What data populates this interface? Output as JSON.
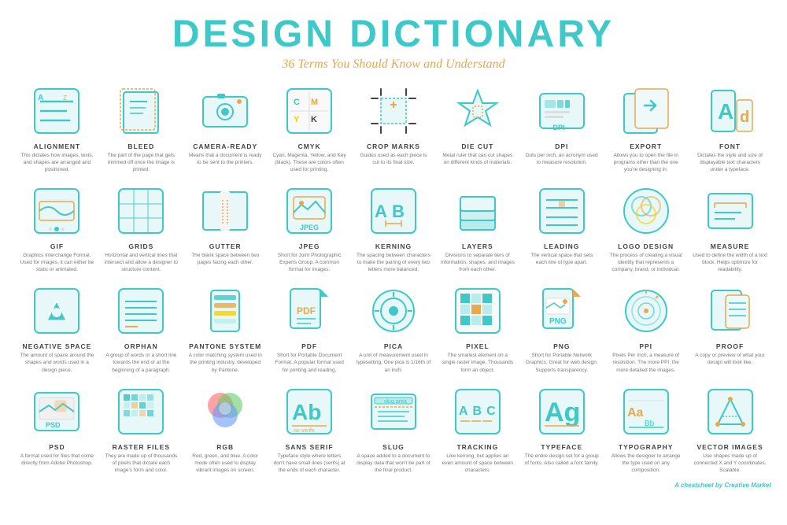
{
  "header": {
    "title": "DESIGN DICTIONARY",
    "subtitle": "36 Terms You Should Know and Understand"
  },
  "footer": {
    "prefix": "A cheatsheet by",
    "brand": "Creative Market"
  },
  "terms": [
    {
      "name": "ALIGNMENT",
      "desc": "This dictates how images, texts, and shapes are arranged and positioned."
    },
    {
      "name": "BLEED",
      "desc": "The part of the page that gets trimmed off once the image is printed."
    },
    {
      "name": "CAMERA-READY",
      "desc": "Means that a document is ready to be sent to the printers."
    },
    {
      "name": "CMYK",
      "desc": "Cyan, Magenta, Yellow, and Key (black). These are colors often used for printing."
    },
    {
      "name": "CROP MARKS",
      "desc": "Guides used as each piece is cut to its final size."
    },
    {
      "name": "DIE CUT",
      "desc": "Metal ruler that can cut shapes on different kinds of materials."
    },
    {
      "name": "DPI",
      "desc": "Dots per inch, an acronym used to measure resolution."
    },
    {
      "name": "EXPORT",
      "desc": "Allows you to open the file in programs other than the one you're designing in."
    },
    {
      "name": "FONT",
      "desc": "Dictates the style and size of displayable text characters under a typeface."
    },
    {
      "name": "GIF",
      "desc": "Graphics Interchange Format. Used for images, it can either be static or animated."
    },
    {
      "name": "GRIDS",
      "desc": "Horizontal and vertical lines that intersect and allow a designer to structure content."
    },
    {
      "name": "GUTTER",
      "desc": "The blank space between two pages facing each other."
    },
    {
      "name": "JPEG",
      "desc": "Short for Joint Photographic Experts Group. A common format for images."
    },
    {
      "name": "KERNING",
      "desc": "The spacing between characters to make the pairing of every two letters more balanced."
    },
    {
      "name": "LAYERS",
      "desc": "Divisions to separate tiers of information, shapes, and images from each other."
    },
    {
      "name": "LEADING",
      "desc": "The vertical space that sets each line of type apart."
    },
    {
      "name": "LOGO DESIGN",
      "desc": "The process of creating a visual identity that represents a company, brand, or individual."
    },
    {
      "name": "MEASURE",
      "desc": "Used to define the width of a text block. Helps optimize for readability."
    },
    {
      "name": "NEGATIVE SPACE",
      "desc": "The amount of space around the shapes and words used in a design piece."
    },
    {
      "name": "ORPHAN",
      "desc": "A group of words or a short line towards the end or at the beginning of a paragraph."
    },
    {
      "name": "PANTONE SYSTEM",
      "desc": "A color matching system used in the printing industry, developed by Pantone."
    },
    {
      "name": "PDF",
      "desc": "Short for Portable Document Format. A popular format used for printing and reading."
    },
    {
      "name": "PICA",
      "desc": "A unit of measurement used in typesetting. One pica is 1/16th of an inch."
    },
    {
      "name": "PIXEL",
      "desc": "The smallest element on a single raster image. Thousands form an object."
    },
    {
      "name": "PNG",
      "desc": "Short for Portable Network Graphics. Great for web design. Supports transparency."
    },
    {
      "name": "PPI",
      "desc": "Pixels Per Inch, a measure of resolution. The more PPI, the more detailed the images."
    },
    {
      "name": "PROOF",
      "desc": "A copy or preview of what your design will look like."
    },
    {
      "name": "PSD",
      "desc": "A format used for files that come directly from Adobe Photoshop."
    },
    {
      "name": "RASTER FILES",
      "desc": "They are made up of thousands of pixels that dictate each image's form and color."
    },
    {
      "name": "RGB",
      "desc": "Red, green, and blue. A color mode often used to display vibrant images on screen."
    },
    {
      "name": "SANS SERIF",
      "desc": "Typeface style where letters don't have small lines (serifs) at the ends of each character."
    },
    {
      "name": "SLUG",
      "desc": "A space added to a document to display data that won't be part of the final product."
    },
    {
      "name": "TRACKING",
      "desc": "Like kerning, but applies an even amount of space between characters."
    },
    {
      "name": "TYPEFACE",
      "desc": "The entire design set for a group of fonts. Also called a font family."
    },
    {
      "name": "TYPOGRAPHY",
      "desc": "Allows the designer to arrange the type used on any composition."
    },
    {
      "name": "VECTOR IMAGES",
      "desc": "Use shapes made up of connected X and Y coordinates. Scalable."
    }
  ]
}
